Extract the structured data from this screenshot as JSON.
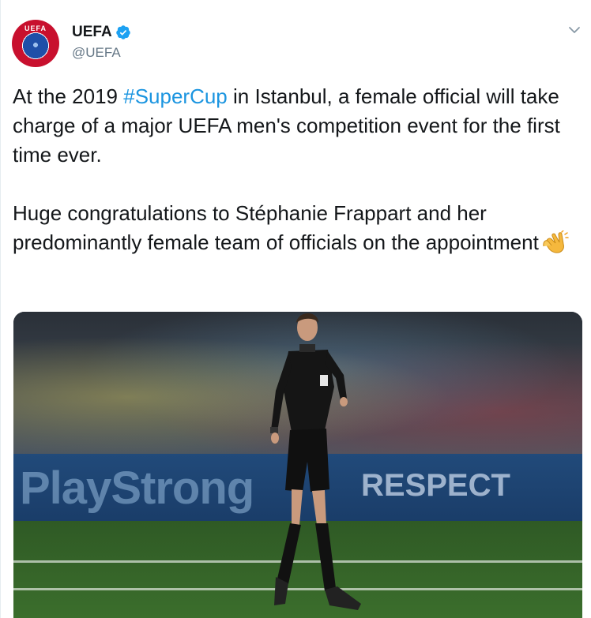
{
  "tweet": {
    "author": {
      "display_name": "UEFA",
      "handle": "@UEFA",
      "avatar_text": "UEFA",
      "verified": true
    },
    "text": {
      "p1_before": "At the 2019 ",
      "hashtag": "#SuperCup",
      "p1_after": " in Istanbul, a female official will take charge of a major UEFA men's competition event for the first time ever.",
      "p2": "Huge congratulations to Stéphanie Frappart and her predominantly female team of officials on the appointment",
      "emoji": "clapping-hands"
    },
    "media": {
      "board_left": "PlayStrong",
      "board_right": "RESPECT"
    }
  },
  "colors": {
    "link": "#1b95e0",
    "verified": "#1da1f2",
    "text": "#14171a",
    "secondary": "#657786"
  }
}
